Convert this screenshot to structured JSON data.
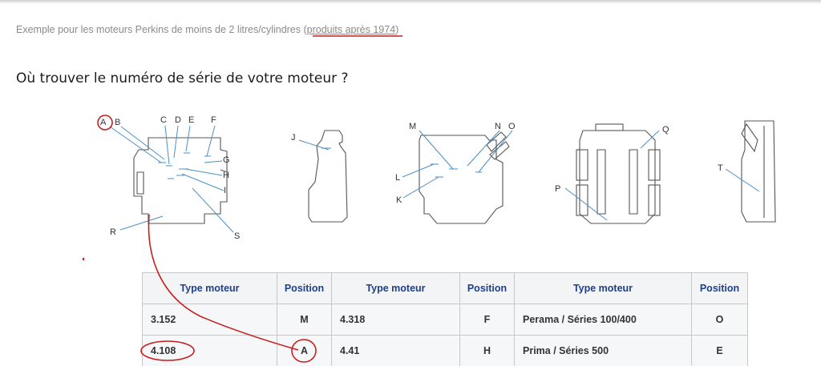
{
  "intro": {
    "text": "Exemple pour les moteurs Perkins de moins de 2 litres/cylindres (",
    "link": "produits après 1974",
    "close": ")"
  },
  "heading": "Où trouver le numéro de série de votre moteur ?",
  "diagram": {
    "labels": [
      "A",
      "B",
      "C",
      "D",
      "E",
      "F",
      "G",
      "H",
      "I",
      "R",
      "S",
      "J",
      "M",
      "N",
      "O",
      "L",
      "K",
      "Q",
      "P",
      "T"
    ]
  },
  "table": {
    "headers": [
      "Type moteur",
      "Position",
      "Type moteur",
      "Position",
      "Type moteur",
      "Position"
    ],
    "rows": [
      [
        "3.152",
        "M",
        "4.318",
        "F",
        "Perama / Séries 100/400",
        "O"
      ],
      [
        "4.108",
        "A",
        "4.41",
        "H",
        "Prima / Séries 500",
        "E"
      ]
    ]
  },
  "colors": {
    "annotation": "#c81e1e",
    "header_text": "#1f3f8b",
    "leader": "#4a8fc4"
  }
}
